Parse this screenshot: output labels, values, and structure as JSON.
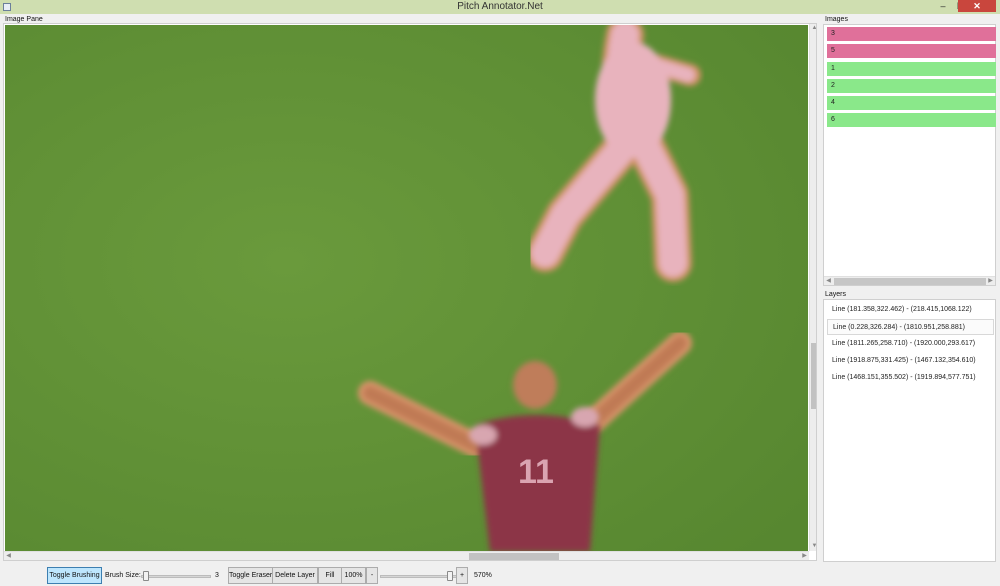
{
  "window": {
    "title": "Pitch Annotator.Net",
    "minimize_glyph": "–",
    "maximize_glyph": "❐",
    "close_glyph": "✕"
  },
  "image_pane": {
    "label": "Image Pane",
    "jersey_number": "11",
    "colors": {
      "grass": "#5f8f34",
      "player_pink": "#e8b3bd",
      "player_maroon": "#8c3447",
      "annotation_outline": "#d9946a"
    }
  },
  "images_panel": {
    "label": "Images",
    "items": [
      {
        "label": "3",
        "status": "unannotated",
        "color": "#e0709a"
      },
      {
        "label": "5",
        "status": "unannotated",
        "color": "#e0709a"
      },
      {
        "label": "1",
        "status": "annotated",
        "color": "#8ae88a"
      },
      {
        "label": "2",
        "status": "annotated",
        "color": "#8ae88a"
      },
      {
        "label": "4",
        "status": "annotated",
        "color": "#8ae88a"
      },
      {
        "label": "6",
        "status": "annotated",
        "color": "#8ae88a"
      }
    ]
  },
  "layers_panel": {
    "label": "Layers",
    "selected_index": 1,
    "items": [
      {
        "label": "Line (181.358,322.462) - (218.415,1068.122)"
      },
      {
        "label": "Line (0.228,326.284) - (1810.951,258.881)"
      },
      {
        "label": "Line (1811.265,258.710) - (1920.000,293.617)"
      },
      {
        "label": "Line (1918.875,331.425) - (1467.132,354.610)"
      },
      {
        "label": "Line (1468.151,355.502) - (1919.894,577.751)"
      }
    ]
  },
  "toolbar": {
    "toggle_brushing_label": "Toggle Brushing",
    "toggle_brushing_active": true,
    "brush_size_label": "Brush Size:",
    "brush_size_value": "3",
    "toggle_eraser_label": "Toggle Eraser",
    "delete_layer_label": "Delete Layer",
    "fill_label": "Fill",
    "zoom_reset_label": "100%",
    "zoom_out_label": "-",
    "zoom_in_label": "+",
    "zoom_value": "570%",
    "brush_slider_fraction": 0.03,
    "zoom_slider_fraction": 0.95
  }
}
